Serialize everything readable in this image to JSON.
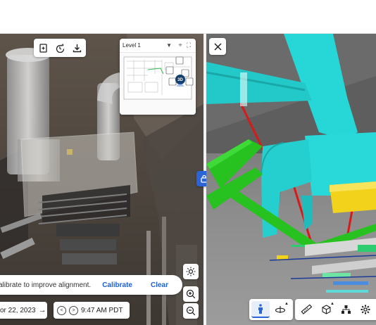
{
  "minimap": {
    "level_label": "Level 1",
    "badge": "3D"
  },
  "calibration": {
    "message": "alibrate to improve alignment.",
    "calibrate_label": "Calibrate",
    "clear_label": "Clear"
  },
  "capture": {
    "date_label": "or 22, 2023",
    "time_label": "9:47 AM PDT"
  },
  "icons": {
    "toolbar": [
      "add-page-icon",
      "clock-plus-icon",
      "download-icon"
    ],
    "side": [
      "brightness-icon",
      "zoom-in-icon",
      "zoom-out-icon"
    ],
    "model_toolbar": [
      "walk-person-icon",
      "orbit-icon",
      "measure-ruler-icon",
      "cube-layers-icon",
      "hierarchy-icon",
      "settings-gear-icon"
    ],
    "other": [
      "close-icon",
      "lock-icon",
      "fullscreen-icon",
      "crosshair-icon",
      "chevron-down-icon",
      "arrow-right-icon",
      "chevron-left-icon",
      "chevron-right-icon"
    ]
  },
  "colors": {
    "accent": "#2a64d6",
    "duct_cyan": "#27d6d6",
    "pipe_green": "#27c21f",
    "pipe_red": "#d61a1a",
    "equipment_yellow": "#f2d21b"
  }
}
